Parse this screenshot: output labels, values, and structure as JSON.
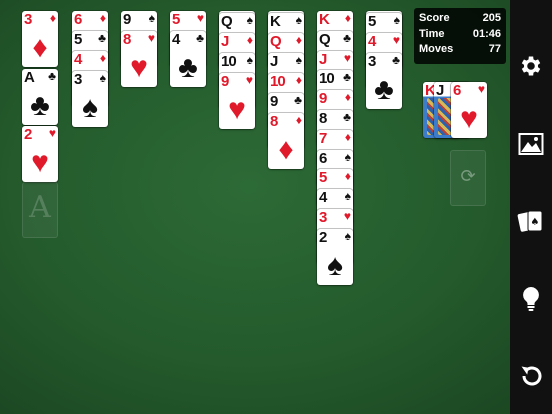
{
  "scoreboard": {
    "score_label": "Score",
    "score_value": "205",
    "time_label": "Time",
    "time_value": "01:46",
    "moves_label": "Moves",
    "moves_value": "77"
  },
  "foundation_placeholder_glyph": "A",
  "colors": {
    "felt": "#245a2c",
    "red_suit": "#e0192b",
    "black_suit": "#111111",
    "sidebar": "#111111"
  },
  "sidebar_icons": [
    "gear-icon",
    "image-icon",
    "cards-icon",
    "lightbulb-icon",
    "undo-icon"
  ],
  "columns": [
    {
      "cards": [
        {
          "rank": "3",
          "suit": "♦",
          "color": "red"
        }
      ]
    },
    {
      "cards": [
        {
          "rank": "A",
          "suit": "♣",
          "color": "black"
        }
      ]
    },
    {
      "cards": [
        {
          "rank": "2",
          "suit": "♥",
          "color": "red"
        }
      ]
    },
    {
      "cards": [
        {
          "rank": "6",
          "suit": "♦",
          "color": "red"
        },
        {
          "rank": "5",
          "suit": "♣",
          "color": "black"
        },
        {
          "rank": "4",
          "suit": "♦",
          "color": "red"
        },
        {
          "rank": "3",
          "suit": "♠",
          "color": "black"
        }
      ]
    },
    {
      "cards": [
        {
          "rank": "9",
          "suit": "♠",
          "color": "black"
        },
        {
          "rank": "8",
          "suit": "♥",
          "color": "red"
        }
      ]
    },
    {
      "cards": [
        {
          "rank": "5",
          "suit": "♥",
          "color": "red"
        },
        {
          "rank": "4",
          "suit": "♣",
          "color": "black"
        }
      ]
    },
    {
      "cards": [
        {
          "rank": "Q",
          "suit": "♠",
          "color": "black"
        },
        {
          "rank": "J",
          "suit": "♦",
          "color": "red"
        },
        {
          "rank": "10",
          "suit": "♠",
          "color": "black"
        },
        {
          "rank": "9",
          "suit": "♥",
          "color": "red"
        }
      ]
    },
    {
      "cards": [
        {
          "rank": "K",
          "suit": "♠",
          "color": "black"
        },
        {
          "rank": "Q",
          "suit": "♦",
          "color": "red"
        },
        {
          "rank": "J",
          "suit": "♠",
          "color": "black"
        },
        {
          "rank": "10",
          "suit": "♦",
          "color": "red"
        },
        {
          "rank": "9",
          "suit": "♣",
          "color": "black"
        },
        {
          "rank": "8",
          "suit": "♦",
          "color": "red"
        }
      ]
    },
    {
      "cards": [
        {
          "rank": "K",
          "suit": "♦",
          "color": "red"
        },
        {
          "rank": "Q",
          "suit": "♣",
          "color": "black"
        },
        {
          "rank": "J",
          "suit": "♥",
          "color": "red"
        },
        {
          "rank": "10",
          "suit": "♣",
          "color": "black"
        },
        {
          "rank": "9",
          "suit": "♦",
          "color": "red"
        },
        {
          "rank": "8",
          "suit": "♣",
          "color": "black"
        },
        {
          "rank": "7",
          "suit": "♦",
          "color": "red"
        },
        {
          "rank": "6",
          "suit": "♠",
          "color": "black"
        },
        {
          "rank": "5",
          "suit": "♦",
          "color": "red"
        },
        {
          "rank": "4",
          "suit": "♠",
          "color": "black"
        },
        {
          "rank": "3",
          "suit": "♥",
          "color": "red"
        },
        {
          "rank": "2",
          "suit": "♠",
          "color": "black"
        }
      ]
    },
    {
      "cards": [
        {
          "rank": "5",
          "suit": "♠",
          "color": "black"
        },
        {
          "rank": "4",
          "suit": "♥",
          "color": "red"
        },
        {
          "rank": "3",
          "suit": "♣",
          "color": "black"
        }
      ]
    }
  ],
  "waste": [
    {
      "rank": "K",
      "suit": "♦",
      "color": "red",
      "picture": true
    },
    {
      "rank": "J",
      "suit": "♠",
      "color": "black",
      "picture": true
    },
    {
      "rank": "6",
      "suit": "♥",
      "color": "red",
      "picture": false
    }
  ],
  "stock_empty_icon": "recycle-icon"
}
